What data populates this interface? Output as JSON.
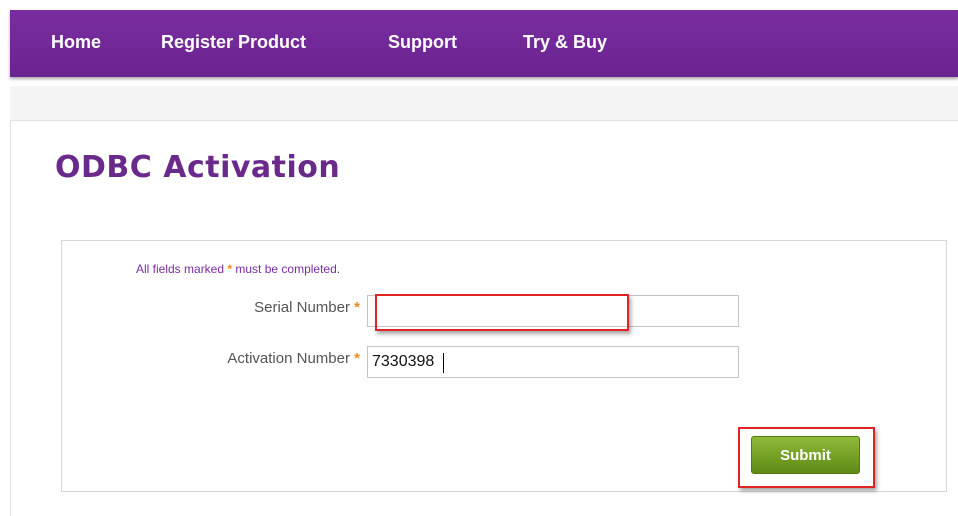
{
  "nav": {
    "items": [
      {
        "label": "Home"
      },
      {
        "label": "Register Product"
      },
      {
        "label": "Support"
      },
      {
        "label": "Try & Buy"
      }
    ]
  },
  "page": {
    "title": "ODBC Activation"
  },
  "form": {
    "note_before": "All fields marked",
    "note_after": "must be completed.",
    "required_mark": "*",
    "serial": {
      "label": "Serial Number",
      "value": ""
    },
    "activation": {
      "label": "Activation Number",
      "value": "7330398"
    },
    "submit_label": "Submit"
  },
  "colors": {
    "nav_purple": "#7a2da0",
    "title_purple": "#6a2a8c",
    "required_orange": "#ee8a1b",
    "submit_green": "#6f9c22",
    "highlight_red": "#e02424"
  }
}
